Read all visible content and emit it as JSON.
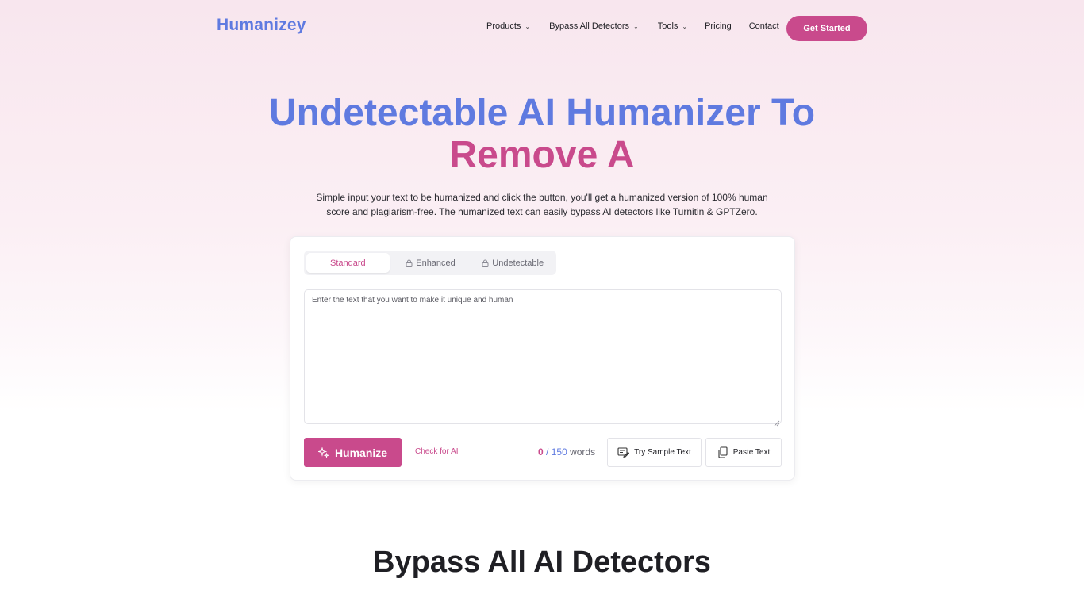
{
  "brand": {
    "logo": "Humanizey"
  },
  "nav": {
    "products": "Products",
    "bypass": "Bypass All Detectors",
    "tools": "Tools",
    "pricing": "Pricing",
    "contact": "Contact",
    "cta": "Get Started"
  },
  "hero": {
    "title_line1": "Undetectable AI Humanizer To",
    "title_line2": "Remove A",
    "subtitle": "Simple input your text to be humanized and click the button, you'll get a humanized version of 100% human score and plagiarism-free. The humanized text can easily bypass AI detectors like Turnitin & GPTZero."
  },
  "editor": {
    "modes": [
      "Standard",
      "Enhanced",
      "Undetectable"
    ],
    "active_mode": "Standard",
    "placeholder": "Enter the text that you want to make it unique and human",
    "humanize_label": "Humanize",
    "check_ai_label": "Check for AI",
    "word_count": "0",
    "word_separator": "/",
    "word_limit": "150",
    "words_label": "words",
    "sample_label": "Try Sample Text",
    "paste_label": "Paste Text"
  },
  "section": {
    "title": "Bypass All AI Detectors"
  },
  "colors": {
    "blue": "#5f7ae0",
    "pink": "#c94a8c"
  },
  "icons": [
    "chevron-down-icon",
    "lock-icon",
    "sparkle-icon",
    "sample-text-icon",
    "clipboard-icon",
    "resize-grip-icon"
  ]
}
